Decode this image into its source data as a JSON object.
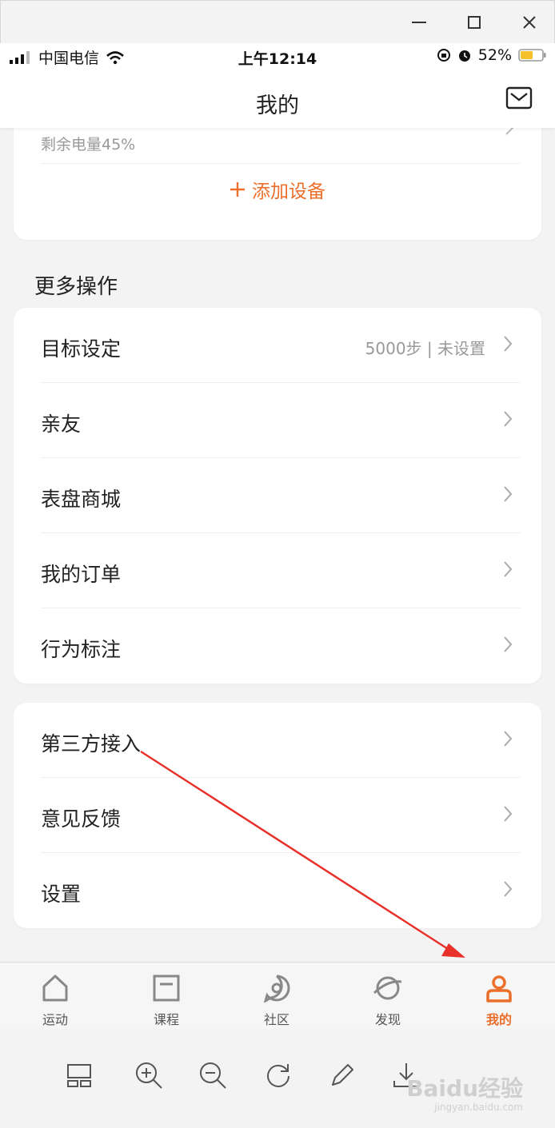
{
  "status_bar": {
    "carrier": "中国电信",
    "time": "上午12:14",
    "battery": "52%"
  },
  "nav": {
    "title": "我的"
  },
  "device": {
    "battery_text": "剩余电量45%",
    "add_label": "添加设备"
  },
  "more_section": {
    "title": "更多操作"
  },
  "card1_items": [
    {
      "label": "目标设定",
      "value": "5000步 | 未设置"
    },
    {
      "label": "亲友"
    },
    {
      "label": "表盘商城"
    },
    {
      "label": "我的订单"
    },
    {
      "label": "行为标注"
    }
  ],
  "card2_items": [
    {
      "label": "第三方接入"
    },
    {
      "label": "意见反馈"
    },
    {
      "label": "设置"
    }
  ],
  "tabs": [
    {
      "label": "运动",
      "icon": "home-icon"
    },
    {
      "label": "课程",
      "icon": "course-icon"
    },
    {
      "label": "社区",
      "icon": "community-icon"
    },
    {
      "label": "发现",
      "icon": "discover-icon"
    },
    {
      "label": "我的",
      "icon": "profile-icon",
      "active": true
    }
  ],
  "colors": {
    "accent": "#ec6e2b",
    "arrow": "#e8312b"
  },
  "watermark": {
    "text": "Baidu经验",
    "sub": "jingyan.baidu.com"
  }
}
